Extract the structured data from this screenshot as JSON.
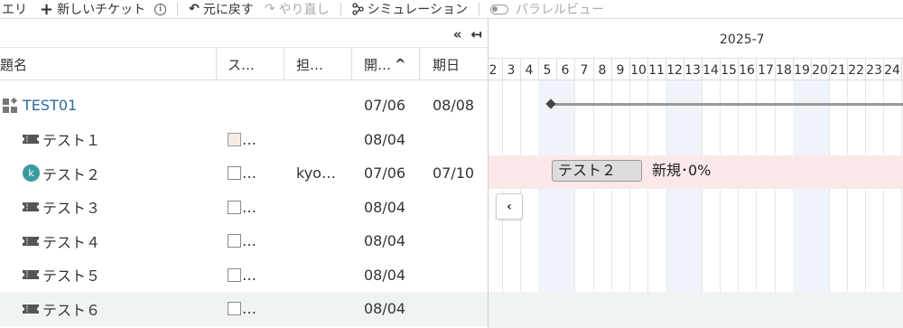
{
  "toolbar": {
    "query_label": "エリ",
    "new_ticket_label": "新しいチケット",
    "new_ticket_icon": "+",
    "info_icon": "i",
    "undo_label": "元に戻す",
    "undo_icon": "↶",
    "redo_label": "やり直し",
    "redo_icon": "↷",
    "simulation_label": "シミュレーション",
    "parallel_view_label": "パラレルビュー"
  },
  "grid": {
    "collapse_all": "«",
    "collapse_left": "↤",
    "columns": {
      "subject": "題名",
      "status": "ス…",
      "assignee": "担…",
      "start": "開…",
      "start_sort": "^",
      "due": "期日"
    },
    "rows": [
      {
        "type": "project",
        "subject": "TEST01",
        "status": "",
        "assignee": "",
        "start": "07/06",
        "due": "08/08"
      },
      {
        "type": "ticket",
        "subject": "テスト１",
        "status": "…",
        "assignee": "",
        "start": "08/04",
        "due": ""
      },
      {
        "type": "ticket-avatar",
        "avatar": "k",
        "subject": "テスト２",
        "status": "…",
        "assignee": "kyo…",
        "start": "07/06",
        "due": "07/10"
      },
      {
        "type": "ticket",
        "subject": "テスト３",
        "status": "…",
        "assignee": "",
        "start": "08/04",
        "due": ""
      },
      {
        "type": "ticket",
        "subject": "テスト４",
        "status": "…",
        "assignee": "",
        "start": "08/04",
        "due": ""
      },
      {
        "type": "ticket",
        "subject": "テスト５",
        "status": "…",
        "assignee": "",
        "start": "08/04",
        "due": ""
      },
      {
        "type": "ticket",
        "subject": "テスト６",
        "status": "…",
        "assignee": "",
        "start": "08/04",
        "due": ""
      }
    ]
  },
  "gantt": {
    "month": "2025-7",
    "days": [
      "2",
      "3",
      "4",
      "5",
      "6",
      "7",
      "8",
      "9",
      "10",
      "11",
      "12",
      "13",
      "14",
      "15",
      "16",
      "17",
      "18",
      "19",
      "20",
      "21",
      "22",
      "23",
      "24"
    ],
    "weekend_days": [
      "5",
      "6",
      "12",
      "13",
      "19",
      "20"
    ],
    "bar_label": "テスト２",
    "bar_status": "新規･0%",
    "scroll_left_icon": "‹"
  },
  "colors": {
    "project_link": "#2d6b9a",
    "avatar": "#3b9aa0",
    "weekend": "#eef4fa",
    "highlight_row": "#fbe9e9",
    "selected_row": "#f0f3f3"
  }
}
